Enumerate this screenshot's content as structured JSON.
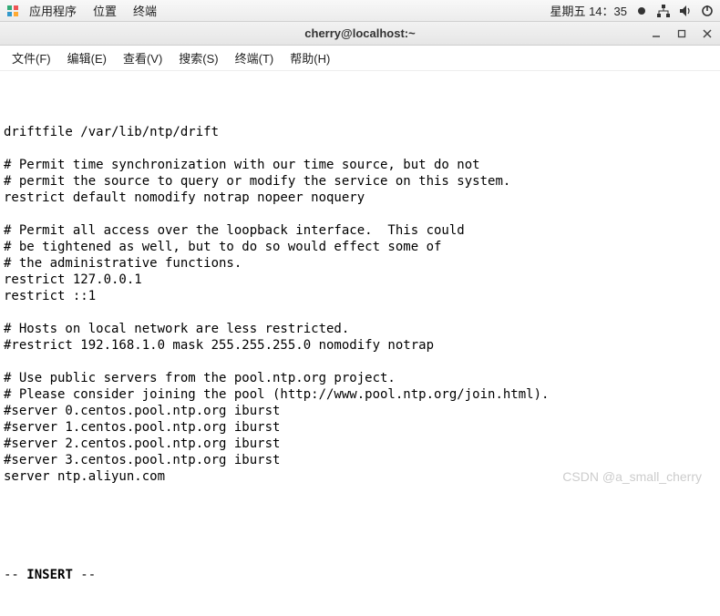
{
  "top_panel": {
    "apps": "应用程序",
    "places": "位置",
    "terminal": "终端",
    "clock": "星期五 14：35",
    "icons": {
      "logo": "logo-icon",
      "network": "network-icon",
      "volume": "volume-icon",
      "power": "power-icon",
      "dot": "record-dot-icon"
    }
  },
  "window": {
    "title": "cherry@localhost:~",
    "minimize": "_",
    "maximize": "□",
    "close": "×"
  },
  "menubar": {
    "file": "文件(F)",
    "edit": "编辑(E)",
    "view": "查看(V)",
    "search": "搜索(S)",
    "terminal": "终端(T)",
    "help": "帮助(H)"
  },
  "terminal_lines": [
    "",
    "driftfile /var/lib/ntp/drift",
    "",
    "# Permit time synchronization with our time source, but do not",
    "# permit the source to query or modify the service on this system.",
    "restrict default nomodify notrap nopeer noquery",
    "",
    "# Permit all access over the loopback interface.  This could",
    "# be tightened as well, but to do so would effect some of",
    "# the administrative functions.",
    "restrict 127.0.0.1",
    "restrict ::1",
    "",
    "# Hosts on local network are less restricted.",
    "#restrict 192.168.1.0 mask 255.255.255.0 nomodify notrap",
    "",
    "# Use public servers from the pool.ntp.org project.",
    "# Please consider joining the pool (http://www.pool.ntp.org/join.html).",
    "#server 0.centos.pool.ntp.org iburst",
    "#server 1.centos.pool.ntp.org iburst",
    "#server 2.centos.pool.ntp.org iburst",
    "#server 3.centos.pool.ntp.org iburst",
    "server ntp.aliyun.com"
  ],
  "status_prefix": "-- ",
  "status_mode": "INSERT",
  "status_suffix": " --",
  "watermark": "CSDN @a_small_cherry"
}
